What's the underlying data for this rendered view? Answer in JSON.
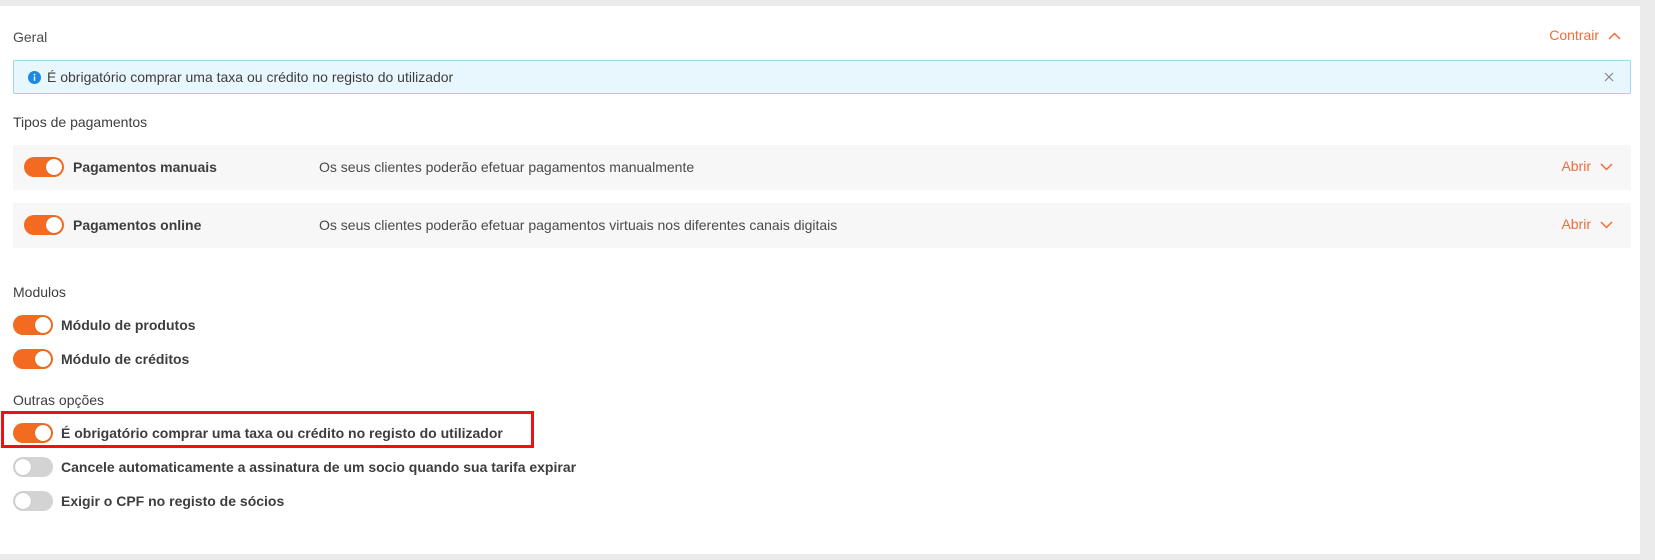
{
  "header": {
    "title": "Geral",
    "collapse_label": "Contrair"
  },
  "alert": {
    "text": "É obrigatório comprar uma taxa ou crédito no registo do utilizador"
  },
  "payment_types": {
    "label": "Tipos de pagamentos",
    "items": [
      {
        "name": "Pagamentos manuais",
        "description": "Os seus clientes poderão efetuar pagamentos manualmente",
        "open_label": "Abrir",
        "enabled": true
      },
      {
        "name": "Pagamentos online",
        "description": "Os seus clientes poderão efetuar pagamentos virtuais nos diferentes canais digitais",
        "open_label": "Abrir",
        "enabled": true
      }
    ]
  },
  "modules": {
    "label": "Modulos",
    "items": [
      {
        "label": "Módulo de produtos",
        "enabled": true
      },
      {
        "label": "Módulo de créditos",
        "enabled": true
      }
    ]
  },
  "other_options": {
    "label": "Outras opções",
    "items": [
      {
        "label": "É obrigatório comprar uma taxa ou crédito no registo do utilizador",
        "enabled": true
      },
      {
        "label": "Cancele automaticamente a assinatura de um socio quando sua tarifa expirar",
        "enabled": false
      },
      {
        "label": "Exigir o CPF no registo de sócios",
        "enabled": false
      }
    ]
  },
  "colors": {
    "accent": "#f26b21",
    "link": "#f26b3a",
    "alert_bg": "#e8f7fd",
    "alert_border": "#9cd9ef",
    "info_icon": "#1e88e5",
    "highlight": "#ee1111",
    "toggle_off": "#d3d3d3"
  },
  "icons": {
    "collapse": "chevron-up-icon",
    "open": "chevron-down-icon",
    "info": "info-icon",
    "close": "close-icon"
  }
}
